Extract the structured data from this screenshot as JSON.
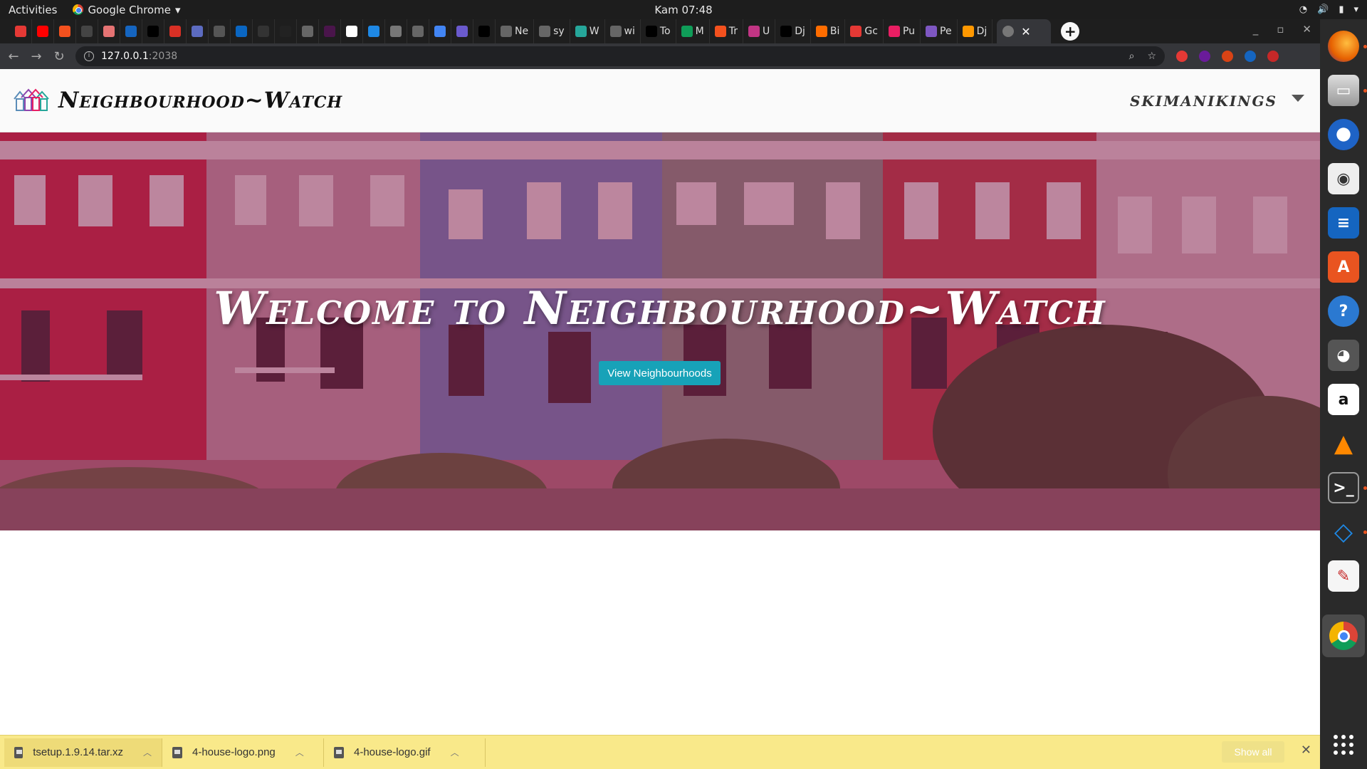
{
  "system": {
    "activities": "Activities",
    "app_name": "Google Chrome",
    "clock": "Kam 07:48"
  },
  "browser": {
    "pinned_tabs": [
      {
        "icon": "red-circle-icon",
        "label": "",
        "color": "#e53935"
      },
      {
        "icon": "youtube-icon",
        "label": "",
        "color": "#ff0000"
      },
      {
        "icon": "orange-square-icon",
        "label": "",
        "color": "#f4511e"
      },
      {
        "icon": "phone-icon",
        "label": "",
        "color": "#444444"
      },
      {
        "icon": "target-icon",
        "label": "",
        "color": "#e57373"
      },
      {
        "icon": "sync-icon",
        "label": "",
        "color": "#1565c0"
      },
      {
        "icon": "medium-icon",
        "label": "",
        "color": "#000000"
      },
      {
        "icon": "gmail-icon",
        "label": "",
        "color": "#d93025"
      },
      {
        "icon": "h-icon",
        "label": "",
        "color": "#5c6bc0"
      },
      {
        "icon": "square-icon",
        "label": "",
        "color": "#555555"
      },
      {
        "icon": "linkedin-icon",
        "label": "",
        "color": "#0a66c2"
      },
      {
        "icon": "car-icon",
        "label": "",
        "color": "#333333"
      },
      {
        "icon": "hackerrank-icon",
        "label": "",
        "color": "#222222"
      },
      {
        "icon": "globe-icon",
        "label": "",
        "color": "#666666"
      },
      {
        "icon": "slack-icon",
        "label": "",
        "color": "#4a154b"
      },
      {
        "icon": "github-icon",
        "label": "",
        "color": "#ffffff"
      },
      {
        "icon": "wave-icon",
        "label": "",
        "color": "#1e88e5"
      },
      {
        "icon": "bulb-icon",
        "label": "",
        "color": "#777777"
      },
      {
        "icon": "globe-icon",
        "label": "",
        "color": "#666666"
      },
      {
        "icon": "docs-icon",
        "label": "",
        "color": "#4285f4"
      },
      {
        "icon": "hat-icon",
        "label": "",
        "color": "#6a5acd"
      },
      {
        "icon": "a-icon",
        "label": "",
        "color": "#000000"
      },
      {
        "icon": "globe-icon",
        "label": "Ne",
        "color": "#666666"
      },
      {
        "icon": "globe-icon",
        "label": "sy",
        "color": "#666666"
      },
      {
        "icon": "d-icon",
        "label": "W",
        "color": "#26a69a"
      },
      {
        "icon": "globe-icon",
        "label": "wi",
        "color": "#666666"
      },
      {
        "icon": "to-icon",
        "label": "To",
        "color": "#000000"
      },
      {
        "icon": "plus-green-icon",
        "label": "M",
        "color": "#0f9d58"
      },
      {
        "icon": "orange-square-icon",
        "label": "Tr",
        "color": "#f4511e"
      },
      {
        "icon": "instagram-icon",
        "label": "U",
        "color": "#c13584"
      },
      {
        "icon": "medium-icon",
        "label": "Dj",
        "color": "#000000"
      },
      {
        "icon": "b-icon",
        "label": "Bi",
        "color": "#ff6d00"
      },
      {
        "icon": "f-icon",
        "label": "Gc",
        "color": "#e53935"
      },
      {
        "icon": "stripes-icon",
        "label": "Pu",
        "color": "#e91e63"
      },
      {
        "icon": "h-purple-icon",
        "label": "Pe",
        "color": "#7e57c2"
      },
      {
        "icon": "fire-icon",
        "label": "Dj",
        "color": "#ff9800"
      }
    ],
    "url_host": "127.0.0.1",
    "url_port": ":2038"
  },
  "site": {
    "brand": "Neighbourhood~Watch",
    "user": "skimanikings",
    "hero_title": "Welcome to Neighbourhood~Watch",
    "cta_label": "View Neighbourhoods"
  },
  "downloads": {
    "items": [
      {
        "name": "tsetup.1.9.14.tar.xz"
      },
      {
        "name": "4-house-logo.png"
      },
      {
        "name": "4-house-logo.gif"
      }
    ],
    "show_all": "Show all"
  },
  "colors": {
    "accent": "#17a2b8",
    "hero_overlay": "#80144680"
  }
}
